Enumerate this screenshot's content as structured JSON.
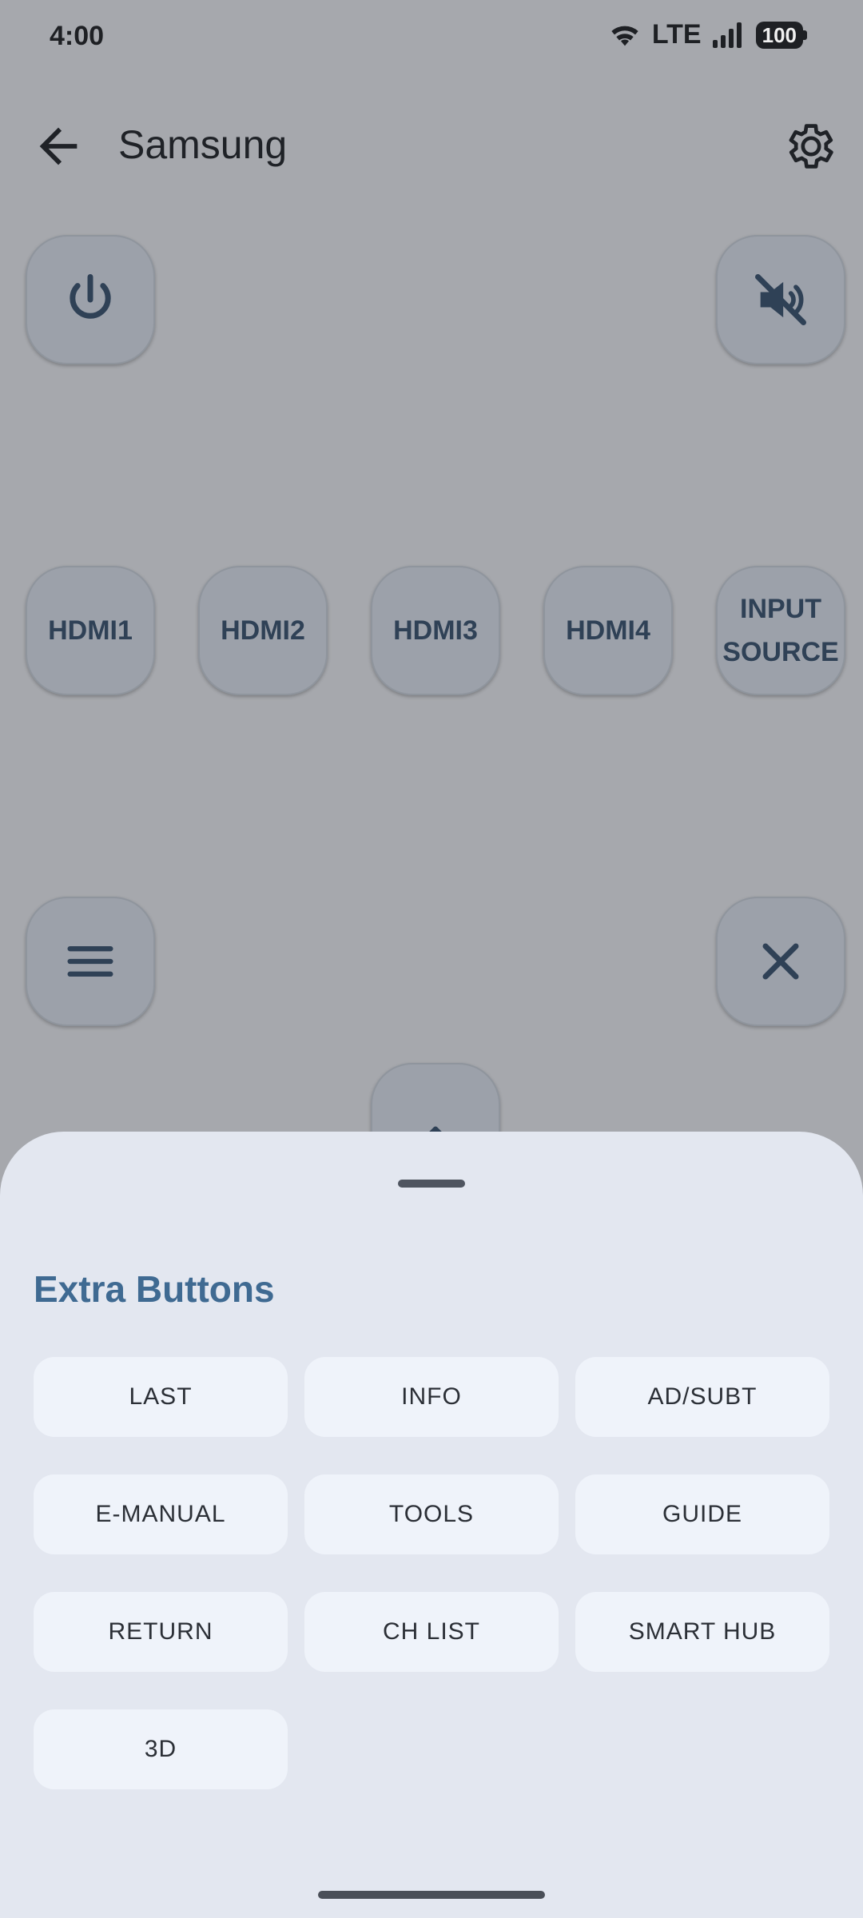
{
  "status_bar": {
    "time": "4:00",
    "network": "LTE",
    "battery": "100"
  },
  "app_bar": {
    "title": "Samsung"
  },
  "remote": {
    "inputs": [
      "HDMI1",
      "HDMI2",
      "HDMI3",
      "HDMI4"
    ],
    "input_source_line1": "INPUT",
    "input_source_line2": "SOURCE"
  },
  "sheet": {
    "title": "Extra Buttons",
    "buttons": [
      "LAST",
      "INFO",
      "AD/SUBT",
      "E-MANUAL",
      "TOOLS",
      "GUIDE",
      "RETURN",
      "CH LIST",
      "SMART HUB",
      "3D"
    ]
  },
  "icons": {
    "back": "arrow-left-icon",
    "settings": "gear-icon",
    "power": "power-icon",
    "mute": "volume-mute-icon",
    "menu": "hamburger-menu-icon",
    "close": "close-icon",
    "up": "chevron-up-icon"
  },
  "colors": {
    "accent": "#3f6a92",
    "button_icon": "#2f4156",
    "sheet_bg": "#e3e7f0"
  }
}
